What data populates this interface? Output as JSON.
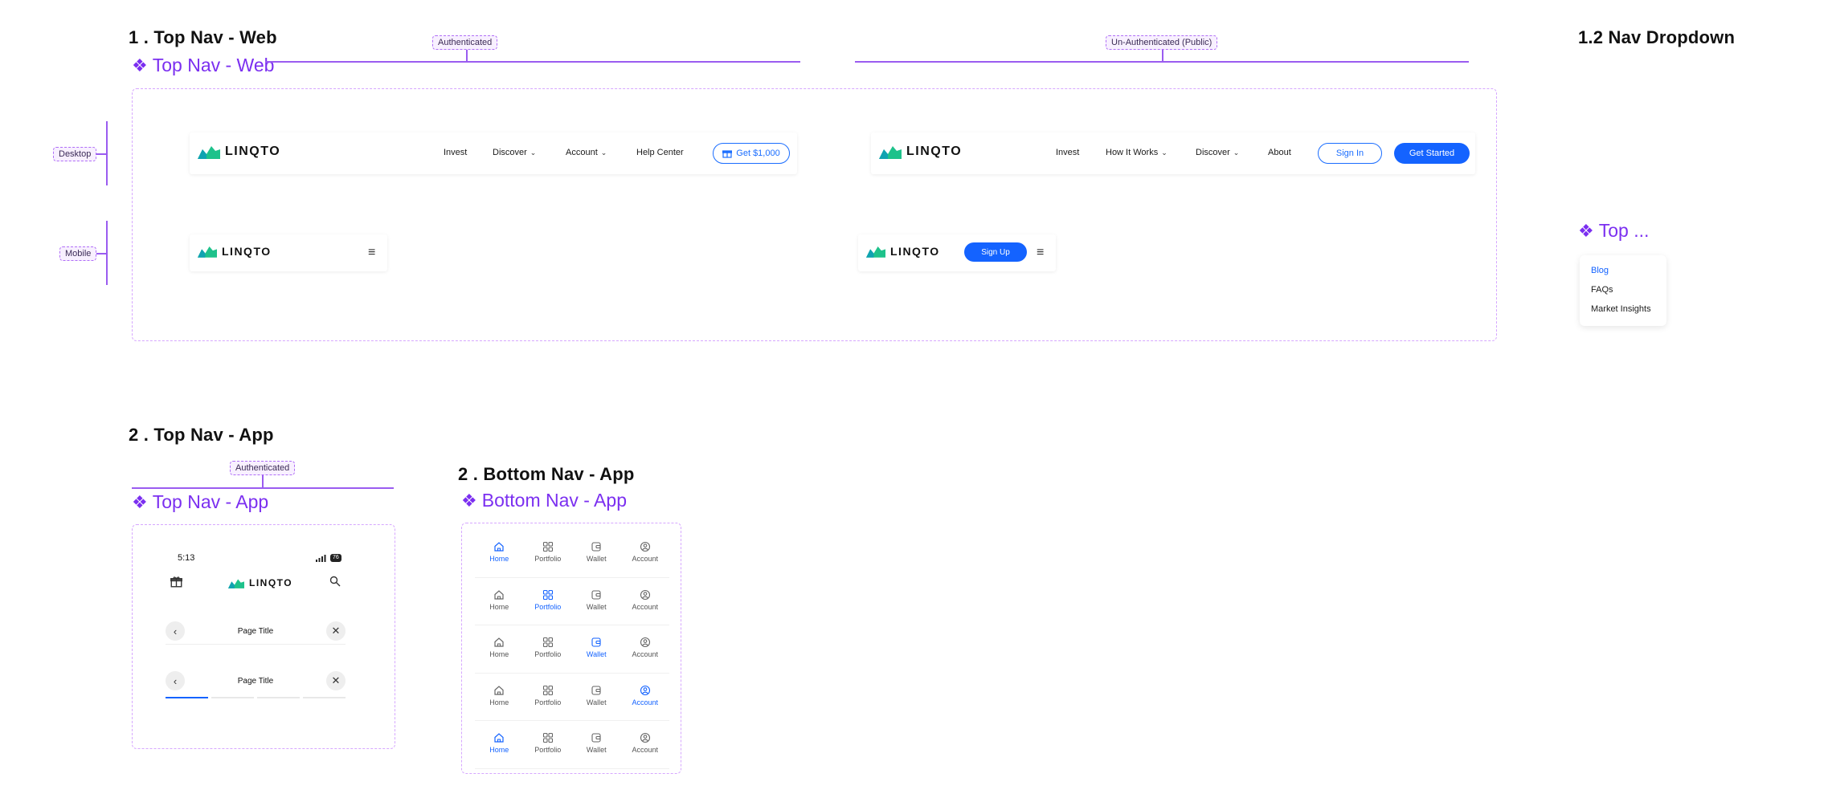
{
  "sections": {
    "s1_title": "1 .  Top Nav - Web",
    "s1_component": "Top Nav - Web",
    "s12_title": "1.2 Nav Dropdown",
    "s12_component": "Top ...",
    "s2_title": "2 .  Top Nav - App",
    "s2_component": "Top Nav - App",
    "s3_title": "2 .  Bottom Nav - App",
    "s3_component": "Bottom Nav - App"
  },
  "tags": {
    "authenticated": "Authenticated",
    "unauthenticated": "Un-Authenticated (Public)",
    "desktop": "Desktop",
    "mobile": "Mobile",
    "app_authenticated": "Authenticated"
  },
  "brand": {
    "logo_text": "LINQTO",
    "logo_green": "#1ec28b",
    "logo_teal": "#0fa3b1",
    "accent": "#1463ff",
    "purple": "#7b2ff0"
  },
  "web_auth_desktop": {
    "links": [
      "Invest",
      "Discover",
      "Account",
      "Help Center"
    ],
    "cta": "Get $1,000"
  },
  "web_public_desktop": {
    "links": [
      "Invest",
      "How It Works",
      "Discover",
      "About"
    ],
    "sign_in": "Sign In",
    "get_started": "Get Started"
  },
  "web_public_mobile": {
    "sign_up": "Sign Up"
  },
  "dropdown": {
    "items": [
      "Blog",
      "FAQs",
      "Market Insights"
    ]
  },
  "app_top": {
    "time": "5:13",
    "battery": "76",
    "page_title_1": "Page Title",
    "page_title_2": "Page Title"
  },
  "bottom_nav": {
    "labels": [
      "Home",
      "Portfolio",
      "Wallet",
      "Account"
    ]
  }
}
